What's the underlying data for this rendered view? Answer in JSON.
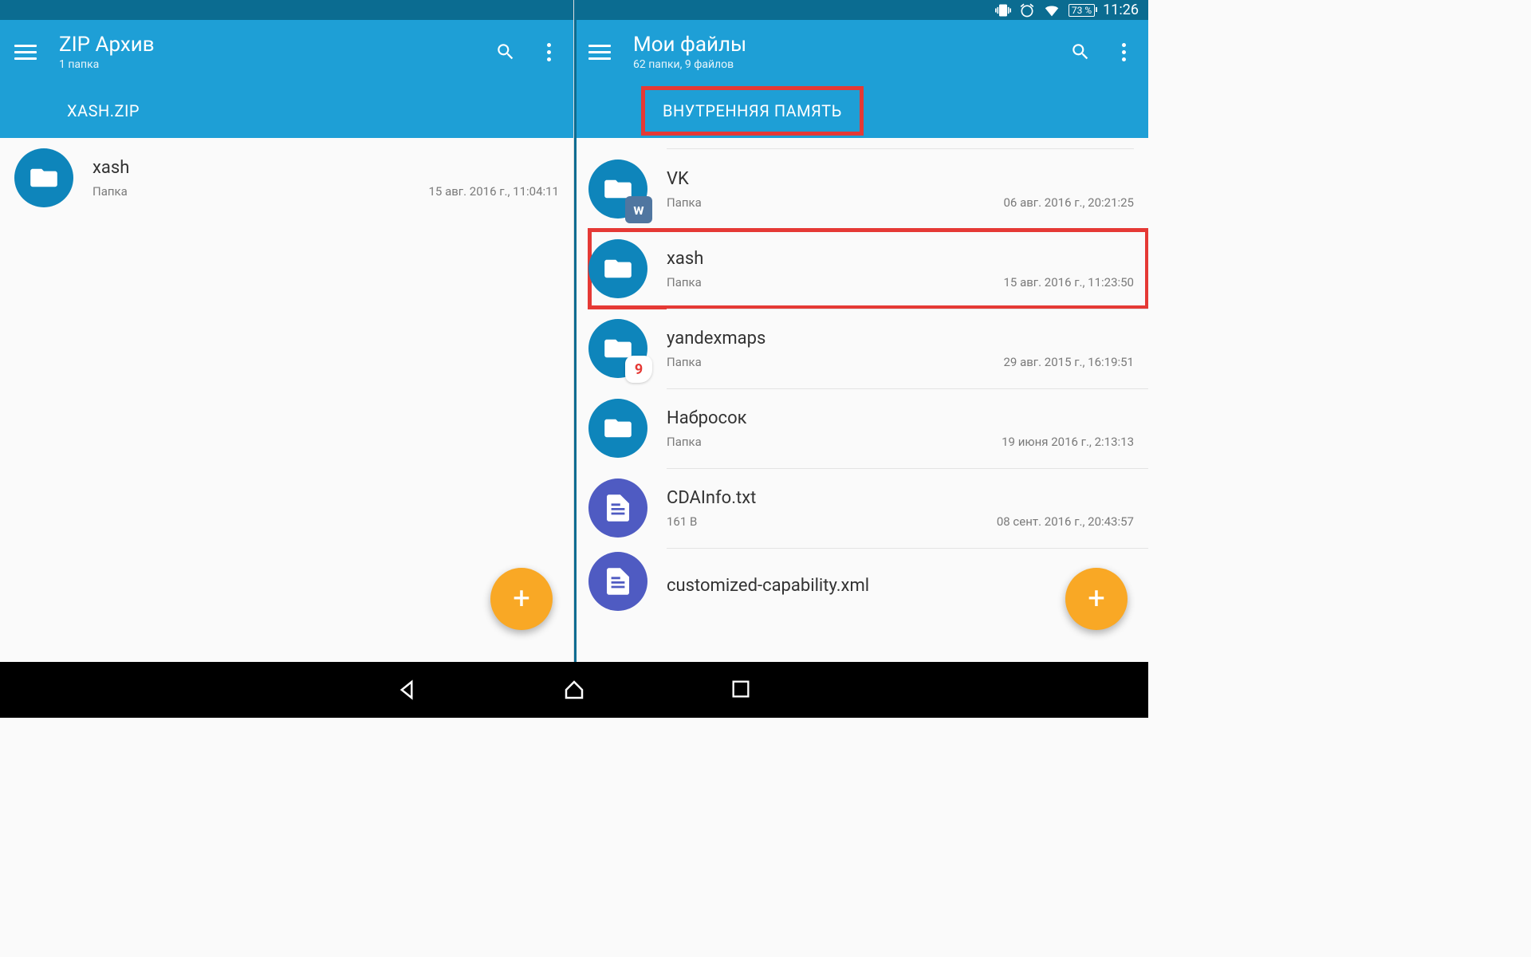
{
  "status": {
    "battery": "73 %",
    "time": "11:26"
  },
  "left": {
    "title": "ZIP Архив",
    "subtitle": "1 папка",
    "breadcrumb": "XASH.ZIP",
    "items": [
      {
        "name": "xash",
        "type_label": "Папка",
        "date": "15 авг. 2016 г., 11:04:11",
        "kind": "folder"
      }
    ]
  },
  "right": {
    "title": "Мои файлы",
    "subtitle": "62 папки, 9 файлов",
    "breadcrumb": "ВНУТРЕННЯЯ ПАМЯТЬ",
    "items": [
      {
        "name": "VK",
        "type_label": "Папка",
        "date": "06 авг. 2016 г., 20:21:25",
        "kind": "folder",
        "badge": "vk",
        "badge_text": "w"
      },
      {
        "name": "xash",
        "type_label": "Папка",
        "date": "15 авг. 2016 г., 11:23:50",
        "kind": "folder",
        "highlighted": true
      },
      {
        "name": "yandexmaps",
        "type_label": "Папка",
        "date": "29 авг. 2015 г., 16:19:51",
        "kind": "folder",
        "badge": "ym",
        "badge_text": "9"
      },
      {
        "name": "Набросок",
        "type_label": "Папка",
        "date": "19 июня 2016 г., 2:13:13",
        "kind": "folder"
      },
      {
        "name": "CDAInfo.txt",
        "type_label": "161 B",
        "date": "08 сент. 2016 г., 20:43:57",
        "kind": "file"
      },
      {
        "name": "customized-capability.xml",
        "type_label": "",
        "date": "",
        "kind": "file"
      }
    ]
  }
}
